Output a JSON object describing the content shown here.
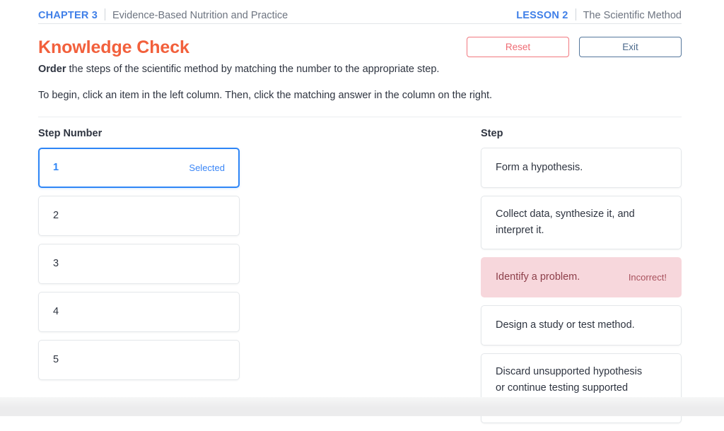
{
  "header": {
    "chapter_label": "CHAPTER 3",
    "chapter_title": "Evidence-Based Nutrition and Practice",
    "lesson_label": "LESSON 2",
    "lesson_title": "The Scientific Method"
  },
  "title": {
    "text": "Knowledge Check",
    "color": "#f2603c"
  },
  "toolbar": {
    "reset_label": "Reset",
    "exit_label": "Exit",
    "reset_color": "#ef6b73",
    "exit_color": "#4c6a8c"
  },
  "instructions": {
    "line1_bold": "Order",
    "line1_rest": " the steps of the scientific method by matching the number to the appropriate step.",
    "line2": "To begin, click an item in the left column. Then, click the matching answer in the column on the right."
  },
  "left_column": {
    "heading": "Step Number",
    "items": [
      {
        "label": "1",
        "state": "selected",
        "badge": "Selected"
      },
      {
        "label": "2",
        "state": "default",
        "badge": ""
      },
      {
        "label": "3",
        "state": "default",
        "badge": ""
      },
      {
        "label": "4",
        "state": "default",
        "badge": ""
      },
      {
        "label": "5",
        "state": "default",
        "badge": ""
      }
    ]
  },
  "right_column": {
    "heading": "Step",
    "items": [
      {
        "label": "Form a hypothesis.",
        "state": "default",
        "badge": ""
      },
      {
        "label": "Collect data, synthesize it, and interpret it.",
        "state": "default",
        "badge": ""
      },
      {
        "label": "Identify a problem.",
        "state": "incorrect",
        "badge": "Incorrect!"
      },
      {
        "label": "Design a study or test method.",
        "state": "default",
        "badge": ""
      },
      {
        "label": "Discard unsupported hypothesis or continue testing supported hypotheses.",
        "state": "default",
        "badge": ""
      }
    ]
  },
  "colors": {
    "accent_blue": "#3f7fe8",
    "selected_blue": "#2f86f6",
    "incorrect_bg": "#f7d7dc",
    "incorrect_text": "#a8505c"
  }
}
